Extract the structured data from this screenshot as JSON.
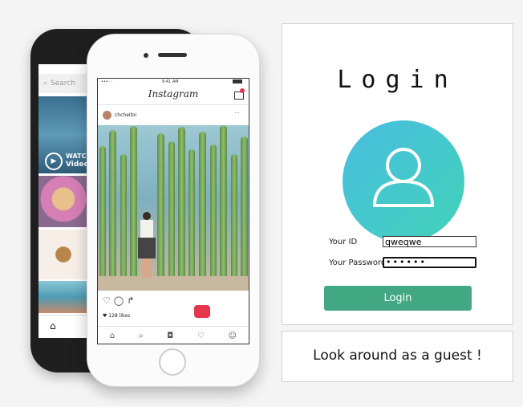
{
  "back_phone": {
    "search_placeholder": "Search",
    "watch_label": "WATCH",
    "video_label": "Video"
  },
  "front_phone": {
    "status_time": "9:41 AM",
    "app_title": "Instagram",
    "username": "chcheitoi",
    "more": "···",
    "likes": "128 likes"
  },
  "login": {
    "title": "Login",
    "id_label": "Your ID",
    "id_value": "qweqwe",
    "password_label": "Your Password",
    "password_value": "••••••",
    "button": "Login"
  },
  "guest": {
    "text": "Look around as a guest !"
  },
  "colors": {
    "accent": "#42a884",
    "avatar_from": "#49bde0",
    "avatar_to": "#41d3b8"
  }
}
